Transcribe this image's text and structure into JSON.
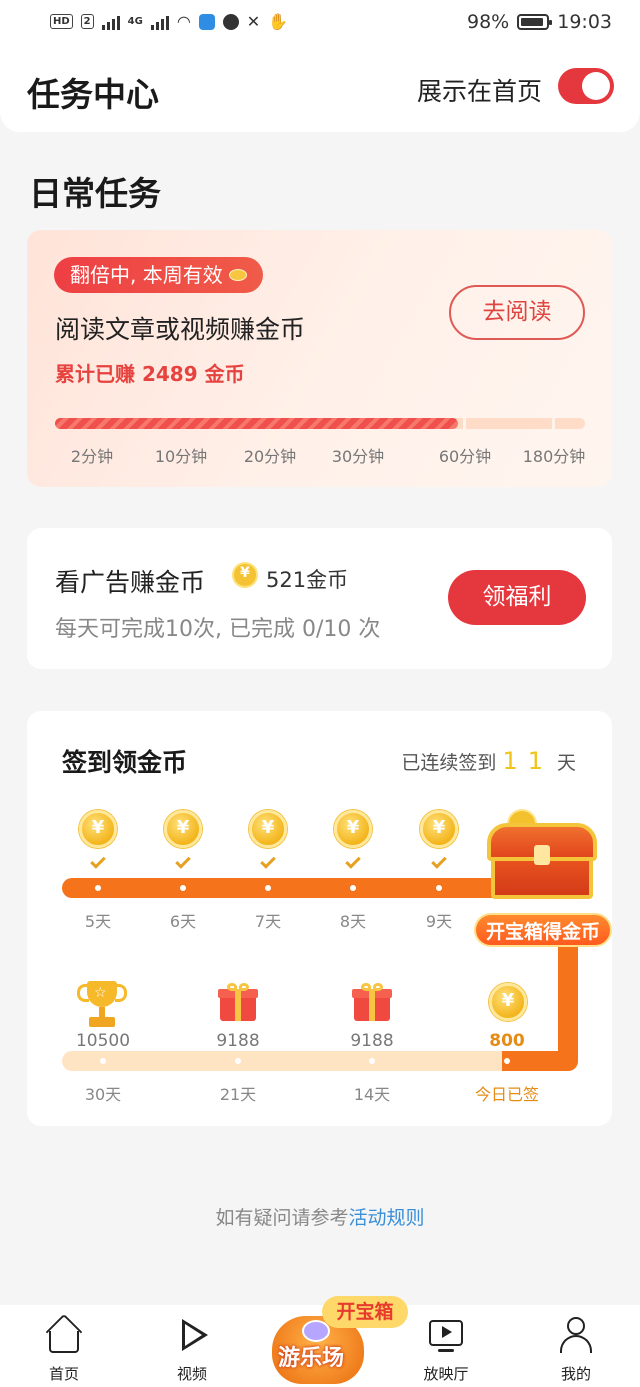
{
  "status_bar": {
    "left_chips": [
      "HD",
      "2"
    ],
    "net_label": "4G",
    "battery": "98%",
    "time": "19:03"
  },
  "header": {
    "title": "任务中心",
    "show_on_home_label": "展示在首页",
    "show_on_home_on": true
  },
  "daily": {
    "section_title": "日常任务",
    "reading": {
      "badge": "翻倍中, 本周有效",
      "title": "阅读文章或视频赚金币",
      "earned": "累计已赚 2489 金币",
      "button": "去阅读",
      "progress": 0.76,
      "milestones": [
        "2分钟",
        "10分钟",
        "20分钟",
        "30分钟",
        "60分钟",
        "180分钟"
      ]
    },
    "ad": {
      "title": "看广告赚金币",
      "reward": "521金币",
      "subtitle": "每天可完成10次, 已完成 0/10 次",
      "button": "领福利"
    }
  },
  "signin": {
    "title": "签到领金币",
    "streak_prefix": "已连续签到",
    "streak_days": "11",
    "streak_suffix": "天",
    "row1_days": [
      "5天",
      "6天",
      "7天",
      "8天",
      "9天"
    ],
    "chest_label": "开宝箱得金币",
    "row2": [
      {
        "value": "10500",
        "day": "30天",
        "icon": "trophy-icon"
      },
      {
        "value": "9188",
        "day": "21天",
        "icon": "gift-icon"
      },
      {
        "value": "9188",
        "day": "14天",
        "icon": "gift-icon"
      },
      {
        "value": "800",
        "day": "今日已签",
        "icon": "coin-icon"
      }
    ]
  },
  "help": {
    "text": "如有疑问请参考",
    "link": "活动规则"
  },
  "nav": {
    "home": "首页",
    "video": "视频",
    "park_badge": "开宝箱",
    "park_label": "游乐场",
    "cinema": "放映厅",
    "mine": "我的"
  },
  "colors": {
    "accent": "#e5383e",
    "track_orange": "#f5731a",
    "link": "#3a8fd8"
  }
}
